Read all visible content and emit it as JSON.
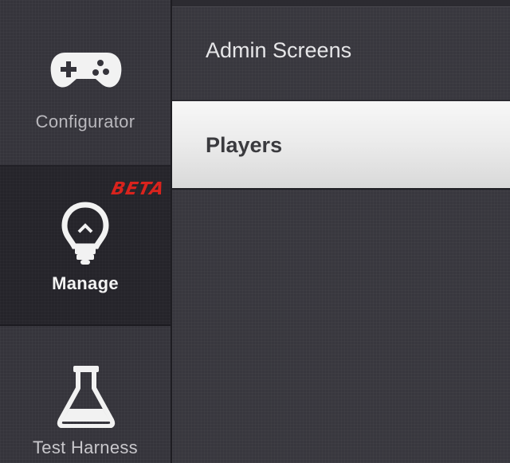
{
  "sidebar": {
    "items": [
      {
        "label": "Configurator",
        "icon": "gamepad-icon",
        "active": false
      },
      {
        "label": "Manage",
        "icon": "lightbulb-icon",
        "active": true,
        "badge": "BETA",
        "badge_color": "#d9231d"
      },
      {
        "label": "Test Harness",
        "icon": "flask-icon",
        "active": false
      }
    ]
  },
  "submenu": {
    "items": [
      {
        "label": "Admin Screens",
        "selected": false
      },
      {
        "label": "Players",
        "selected": true
      }
    ]
  },
  "colors": {
    "background": "#38373e",
    "rail": "#35343b",
    "active_rail": "#25242a",
    "selected_item": "#eeeeee",
    "text_light": "#e6e6e8",
    "text_dark": "#3a3a3e"
  }
}
